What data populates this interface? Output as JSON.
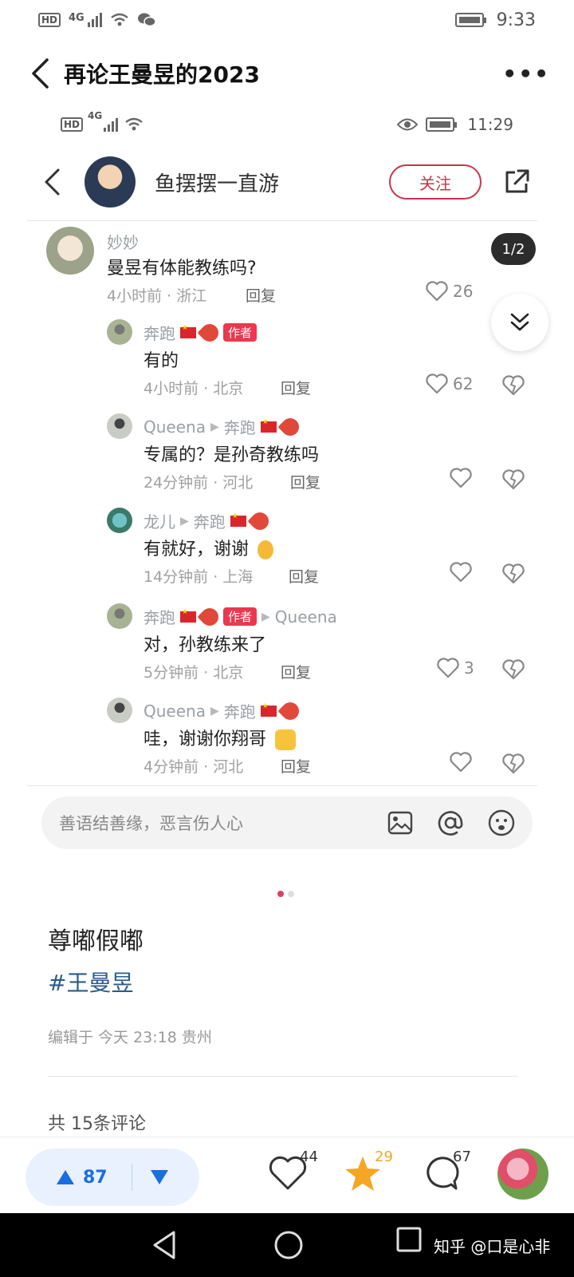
{
  "status_bar": {
    "hd": "HD",
    "network": "4G",
    "time": "9:33"
  },
  "header": {
    "title": "再论王曼昱的2023",
    "more": "•••"
  },
  "inner_status": {
    "hd": "HD",
    "network": "4G",
    "time": "11:29"
  },
  "profile": {
    "username": "鱼摆摆一直游",
    "follow_label": "关注"
  },
  "pager": "1/2",
  "comments": [
    {
      "name": "妙妙",
      "text": "曼昱有体能教练吗?",
      "meta": "4小时前 · 浙江",
      "reply": "回复",
      "likes": "26"
    },
    {
      "name": "奔跑",
      "badge": "作者",
      "text": "有的",
      "meta": "4小时前 · 北京",
      "reply": "回复",
      "likes": "62"
    },
    {
      "name": "Queena",
      "reply_to": "奔跑",
      "text": "专属的？是孙奇教练吗",
      "meta": "24分钟前 · 河北",
      "reply": "回复",
      "likes": ""
    },
    {
      "name": "龙儿",
      "reply_to": "奔跑",
      "text": "有就好，谢谢",
      "meta": "14分钟前 · 上海",
      "reply": "回复",
      "likes": ""
    },
    {
      "name": "奔跑",
      "badge": "作者",
      "reply_to": "Queena",
      "text": "对，孙教练来了",
      "meta": "5分钟前 · 北京",
      "reply": "回复",
      "likes": "3"
    },
    {
      "name": "Queena",
      "reply_to": "奔跑",
      "text": "哇，谢谢你翔哥",
      "meta": "4分钟前 · 河北",
      "reply": "回复",
      "likes": ""
    }
  ],
  "input": {
    "placeholder": "善语结善缘，恶言伤人心"
  },
  "post": {
    "title": "尊嘟假嘟",
    "tag": "#王曼昱",
    "edited": "编辑于 今天 23:18 贵州",
    "total_comments": "共 15条评论"
  },
  "bottom_bar": {
    "vote_count": "87",
    "like_count": "44",
    "star_count": "29",
    "comment_count": "67"
  },
  "watermark": "知乎 @口是心非",
  "colors": {
    "accent_red": "#c8344a",
    "vote_blue": "#1a6ee0",
    "star_orange": "#f5a623"
  }
}
